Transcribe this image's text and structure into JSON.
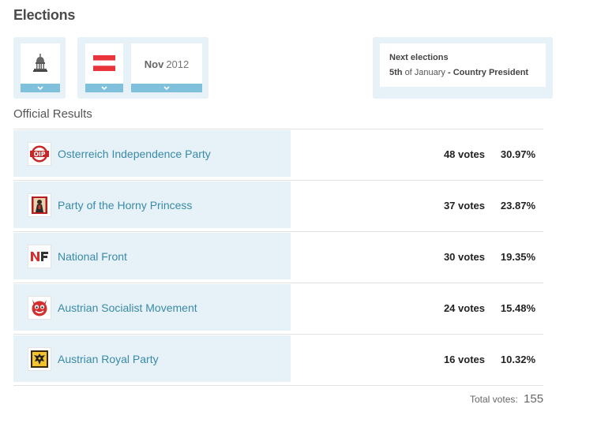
{
  "title": "Elections",
  "selectors": {
    "building_icon": "capitol-building-icon",
    "flag_icon": "austria-flag-icon",
    "date_month": "Nov",
    "date_year": "2012"
  },
  "next_elections": {
    "title": "Next elections",
    "date": "5th",
    "date_suffix": "of January",
    "separator": "-",
    "type": "Country President"
  },
  "section_title": "Official Results",
  "results": [
    {
      "name": "Osterreich Independence Party",
      "votes": "48 votes",
      "percent": "30.97%",
      "icon": "oip-logo-icon"
    },
    {
      "name": "Party of the Horny Princess",
      "votes": "37 votes",
      "percent": "23.87%",
      "icon": "princess-logo-icon"
    },
    {
      "name": "National Front",
      "votes": "30 votes",
      "percent": "19.35%",
      "icon": "nf-logo-icon"
    },
    {
      "name": "Austrian Socialist Movement",
      "votes": "24 votes",
      "percent": "15.48%",
      "icon": "devil-logo-icon"
    },
    {
      "name": "Austrian Royal Party",
      "votes": "16 votes",
      "percent": "10.32%",
      "icon": "eagle-crest-icon"
    }
  ],
  "total": {
    "label": "Total votes:",
    "value": "155"
  },
  "colors": {
    "panel": "#e6f2f8",
    "accent": "#7fc1dc",
    "link": "#3a8aa7"
  }
}
